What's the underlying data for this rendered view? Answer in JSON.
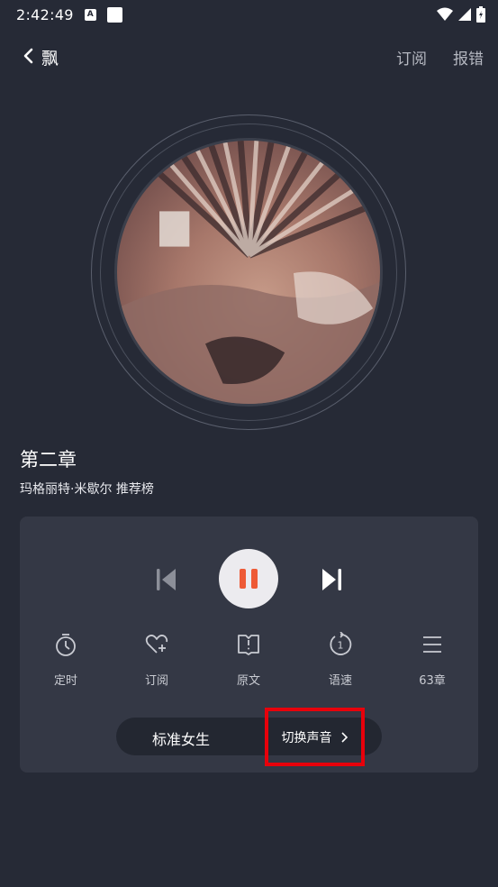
{
  "status_bar": {
    "time": "2:42:49",
    "a_badge": "A"
  },
  "header": {
    "title": "飘",
    "subscribe_label": "订阅",
    "report_label": "报错"
  },
  "chapter": {
    "title": "第二章",
    "subtitle": "玛格丽特·米歇尔  推荐榜"
  },
  "player": {
    "state": "playing",
    "accent_color": "#ee5a36"
  },
  "tools": [
    {
      "icon": "timer-icon",
      "label": "定时"
    },
    {
      "icon": "heart-plus-icon",
      "label": "订阅"
    },
    {
      "icon": "book-icon",
      "label": "原文"
    },
    {
      "icon": "speed-icon",
      "label": "语速"
    },
    {
      "icon": "list-icon",
      "label": "63章"
    }
  ],
  "voice": {
    "current": "标准女生",
    "switch_label": "切换声音"
  },
  "colors": {
    "background": "#262a36",
    "panel": "#343845",
    "highlight_box": "#e8000b"
  }
}
